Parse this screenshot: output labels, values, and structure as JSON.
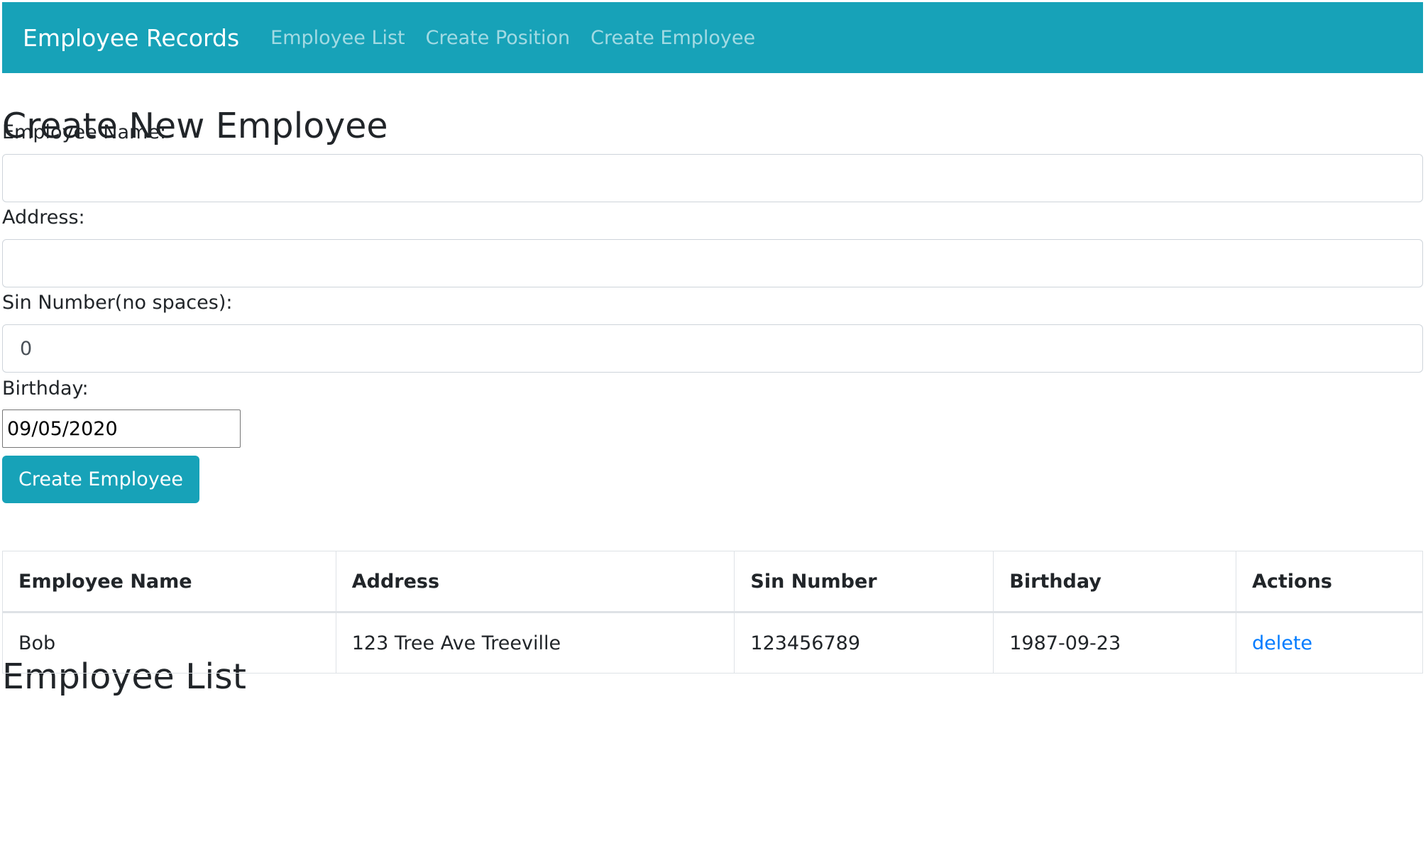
{
  "navbar": {
    "brand": "Employee Records",
    "links": [
      "Employee List",
      "Create Position",
      "Create Employee"
    ],
    "color": "#17a2b8"
  },
  "form": {
    "title": "Create New Employee",
    "name_label": "Employee Name:",
    "name_value": "",
    "address_label": "Address:",
    "address_value": "",
    "sin_label": "Sin Number(no spaces):",
    "sin_value": "0",
    "birthday_label": "Birthday:",
    "birthday_value": "09/05/2020",
    "submit_label": "Create Employee"
  },
  "list": {
    "title": "Employee List",
    "columns": [
      "Employee Name",
      "Address",
      "Sin Number",
      "Birthday",
      "Actions"
    ],
    "rows": [
      {
        "name": "Bob",
        "address": "123 Tree Ave Treeville",
        "sin": "123456789",
        "birthday": "1987-09-23",
        "action": "delete"
      }
    ]
  },
  "colors": {
    "accent": "#17a2b8",
    "link": "#007bff",
    "text": "#212529"
  }
}
